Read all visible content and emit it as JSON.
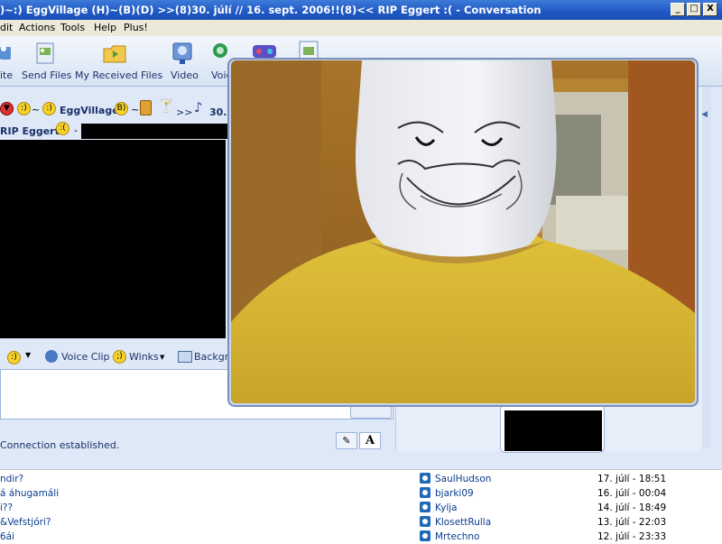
{
  "window": {
    "title": ")~:) EggVillage (H)~(B)(D) >>(8)30. júlí // 16. sept. 2006!!(8)<< RIP Eggert :( - Conversation",
    "controls": [
      "_",
      "□",
      "X"
    ]
  },
  "menu": {
    "items": [
      "dit",
      "Actions",
      "Tools",
      "Help",
      "Plus!"
    ]
  },
  "toolbar": {
    "buttons": [
      {
        "label": "ite",
        "icon": "invite-icon"
      },
      {
        "label": "Send Files",
        "icon": "send-files-icon"
      },
      {
        "label": "My Received Files",
        "icon": "folder-icon"
      },
      {
        "label": "Video",
        "icon": "webcam-icon"
      },
      {
        "label": "Voic",
        "icon": "voice-icon"
      }
    ],
    "logo": "msn"
  },
  "conversation": {
    "to_name": "EggVillage",
    "to_suffix": ">>",
    "to_date": "30.",
    "psm_name": "RIP Eggert"
  },
  "input_toolbar": {
    "voice_clip": "Voice Clip",
    "winks": "Winks",
    "background": "Backgro"
  },
  "status": {
    "text": "Connection established."
  },
  "bottom_list": {
    "rows": [
      {
        "subject": "ndir?",
        "user": "SaulHudson",
        "date": "17. júlí - 18:51"
      },
      {
        "subject": "á áhugamáli",
        "user": "bjarki09",
        "date": "16. júlí - 00:04"
      },
      {
        "subject": "i??",
        "user": "Kylja",
        "date": "14. júlí - 18:49"
      },
      {
        "subject": "&Vefstjóri?",
        "user": "KlosettRulla",
        "date": "13. júlí - 22:03"
      },
      {
        "subject": "6ái",
        "user": "Mrtechno",
        "date": "12. júlí - 23:33"
      }
    ]
  }
}
